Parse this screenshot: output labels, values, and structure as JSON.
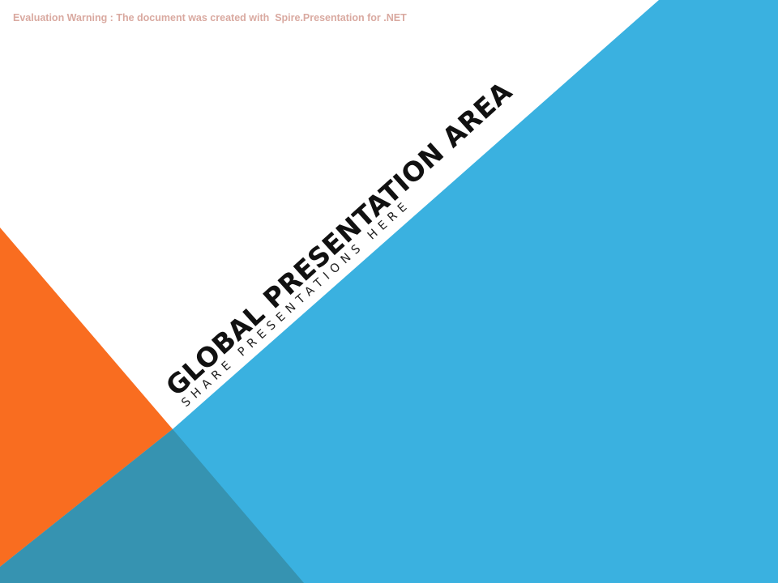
{
  "watermark": {
    "text": "Evaluation Warning : The document was created with  Spire.Presentation for .NET"
  },
  "slide": {
    "title": "GLOBAL PRESENTATION AREA",
    "subtitle": "SHARE PRESENTATIONS HERE"
  },
  "colors": {
    "background": "#ffffff",
    "blue": "#3ab1e0",
    "orange": "#f96d20",
    "teal_overlap": "#3693b1",
    "watermark": "#d9a9a0",
    "title": "#111111"
  }
}
